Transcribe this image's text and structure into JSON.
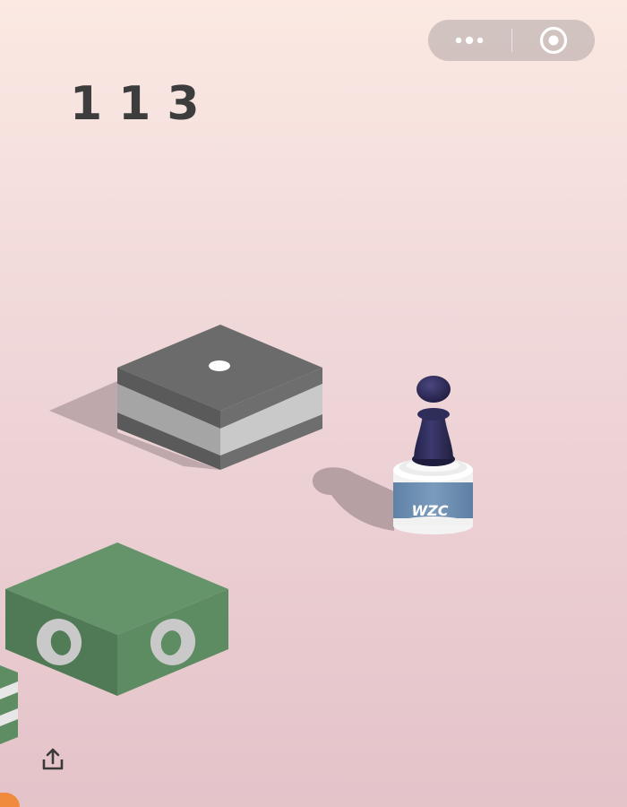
{
  "score": "113",
  "bottle_label": "WZC",
  "icons": {
    "more": "more-dots-icon",
    "close": "target-circle-icon",
    "share": "share-upload-icon"
  },
  "colors": {
    "score": "#3d3d3d",
    "gray_block_top": "#6b6b6b",
    "green_block": "#5f8f63",
    "bottle_label": "#6d8fb0",
    "piece": "#2d2b52"
  }
}
